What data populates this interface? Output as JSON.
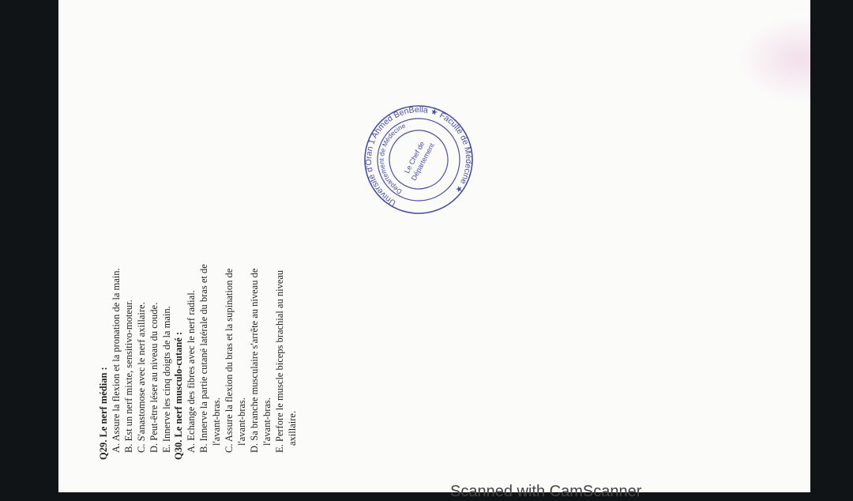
{
  "questions": [
    {
      "title": "Q29. Le nerf médian :",
      "options": [
        "A. Assure la flexion et la pronation de la main.",
        "B. Est un nerf mixte, sensitivo-moteur.",
        "C. S'anastomose avec le nerf axillaire.",
        "D. Peut-être léser au niveau du coude.",
        "E. Innerve les cinq doigts de la main."
      ]
    },
    {
      "title": "Q30. Le nerf musculo-cutané :",
      "options": [
        "A. Echange des fibres avec le nerf radial.",
        "B. Innerve la partie cutané latérale du bras et de l'avant-bras.",
        "C. Assure la flexion du bras et la supination de l'avant-bras.",
        "D. Sa branche musculaire s'arrête au niveau de l'avant-bras.",
        "E. Perfore le muscle biceps brachial au niveau axillaire."
      ]
    }
  ],
  "stamp": {
    "outer_text": "Université d'Oran 1 Ahmed BenBella ★ Faculté de Médecine ★",
    "inner_text": "Département de Médecine",
    "center_line1": "Le Chef de",
    "center_line2": "Département",
    "color": "#4a4f9c"
  },
  "footer": {
    "scanner_text": "Scanned with CamScanner"
  }
}
